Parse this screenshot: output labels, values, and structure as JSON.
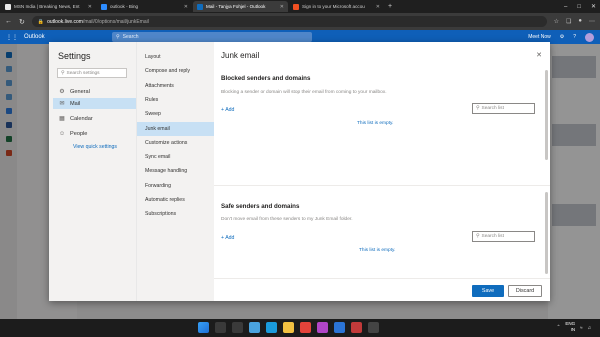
{
  "browser": {
    "tabs": [
      {
        "title": "MSN India | Breaking News, Ent",
        "favicon_color": "#e8e8e8",
        "active": false
      },
      {
        "title": "outlook - Bing",
        "favicon_color": "#2d8cff",
        "active": false
      },
      {
        "title": "Mail - Tanjya Fohjel - Outlook",
        "favicon_color": "#0f6cbd",
        "active": true
      },
      {
        "title": "Sign in to your Microsoft accou",
        "favicon_color": "#f25022",
        "active": false
      }
    ],
    "url_host": "outlook.live.com",
    "url_path": "/mail/0/options/mail/junkEmail"
  },
  "outlook": {
    "brand": "Outlook",
    "search_placeholder": "Search",
    "header_right": "Meet Now"
  },
  "settings": {
    "title": "Settings",
    "search_placeholder": "Search settings",
    "categories": [
      {
        "label": "General",
        "icon": "gear-icon",
        "glyph": "⚙",
        "selected": false
      },
      {
        "label": "Mail",
        "icon": "mail-icon",
        "glyph": "✉",
        "selected": true
      },
      {
        "label": "Calendar",
        "icon": "calendar-icon",
        "glyph": "▦",
        "selected": false
      },
      {
        "label": "People",
        "icon": "people-icon",
        "glyph": "☺",
        "selected": false
      }
    ],
    "quick_settings": "View quick settings",
    "subcategories": [
      {
        "label": "Layout",
        "selected": false
      },
      {
        "label": "Compose and reply",
        "selected": false
      },
      {
        "label": "Attachments",
        "selected": false
      },
      {
        "label": "Rules",
        "selected": false
      },
      {
        "label": "Sweep",
        "selected": false
      },
      {
        "label": "Junk email",
        "selected": true
      },
      {
        "label": "Customize actions",
        "selected": false
      },
      {
        "label": "Sync email",
        "selected": false
      },
      {
        "label": "Message handling",
        "selected": false
      },
      {
        "label": "Forwarding",
        "selected": false
      },
      {
        "label": "Automatic replies",
        "selected": false
      },
      {
        "label": "Subscriptions",
        "selected": false
      }
    ],
    "pane": {
      "title": "Junk email",
      "blocked": {
        "heading": "Blocked senders and domains",
        "description": "Blocking a sender or domain will stop their email from coming to your mailbox.",
        "add_label": "Add",
        "search_placeholder": "Search list",
        "empty_text": "This list is empty."
      },
      "safe": {
        "heading": "Safe senders and domains",
        "description": "Don't move email from these senders to my Junk Email folder.",
        "add_label": "Add",
        "search_placeholder": "Search list",
        "empty_text": "This list is empty."
      },
      "save_label": "Save",
      "discard_label": "Discard"
    }
  },
  "taskbar": {
    "language": "ENG",
    "region": "IN",
    "time": "",
    "date": ""
  },
  "colors": {
    "accent": "#0f6cbd",
    "selected_bg": "#c7e0f4",
    "header_blue": "#0f5fb8"
  }
}
